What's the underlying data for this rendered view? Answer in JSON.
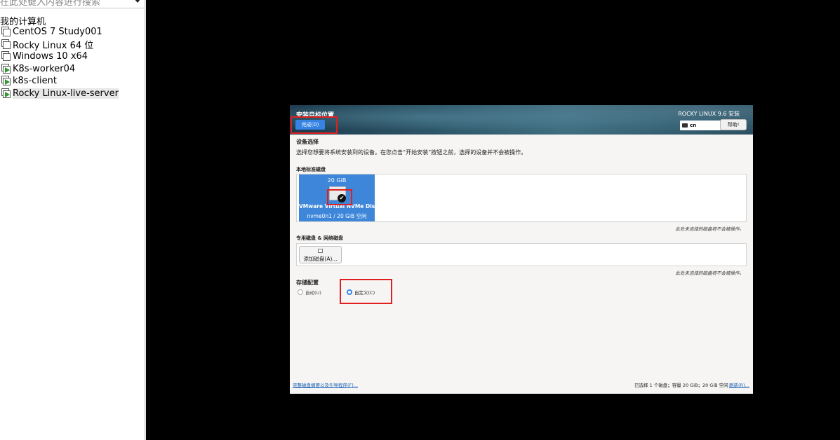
{
  "library": {
    "search_placeholder": "在此处键入内容进行搜索",
    "root_label": "我的计算机",
    "vms": [
      {
        "label": "CentOS 7 Study001",
        "running": false
      },
      {
        "label": "Rocky Linux 64 位",
        "running": false
      },
      {
        "label": "Windows 10 x64",
        "running": false
      },
      {
        "label": "K8s-worker04",
        "running": true
      },
      {
        "label": "k8s-client",
        "running": true
      },
      {
        "label": "Rocky Linux-live-server",
        "running": true,
        "selected": true
      }
    ]
  },
  "installer": {
    "page_title": "安装目标位置",
    "done_button": "完成(D)",
    "product_title": "ROCKY LINUX 9.6 安装",
    "keyboard_layout": "cn",
    "help_button": "帮助!",
    "device_selection_title": "设备选择",
    "device_selection_desc": "选择您想要将系统安装到的设备。在您点击“开始安装”按钮之前，选择的设备并不会被操作。",
    "local_disks_label": "本地标准磁盘",
    "disk": {
      "size": "20 GiB",
      "name": "VMware Virtual NVMe Disk",
      "info": "nvme0n1  /  20 GiB 空闲",
      "selected": true
    },
    "unselected_note": "此处未选择的磁盘将不会被操作。",
    "special_disks_label": "专用磁盘 & 网络磁盘",
    "add_disk_button": "添加磁盘(A)...",
    "storage_config_title": "存储配置",
    "storage_options": [
      {
        "label": "自动(U)",
        "selected": false
      },
      {
        "label": "自定义(C)",
        "selected": true
      }
    ],
    "summary_link": "完整磁盘摘要以及引导程序(F)...",
    "selection_status": "已选择 1 个磁盘；容量 20 GiB；20 GiB 空闲",
    "refresh_link": "刷新(R)..."
  },
  "colors": {
    "accent": "#3584e4",
    "disk_tile": "#3d86d9",
    "annotation": "#e02020",
    "console_bg": "#000000"
  }
}
